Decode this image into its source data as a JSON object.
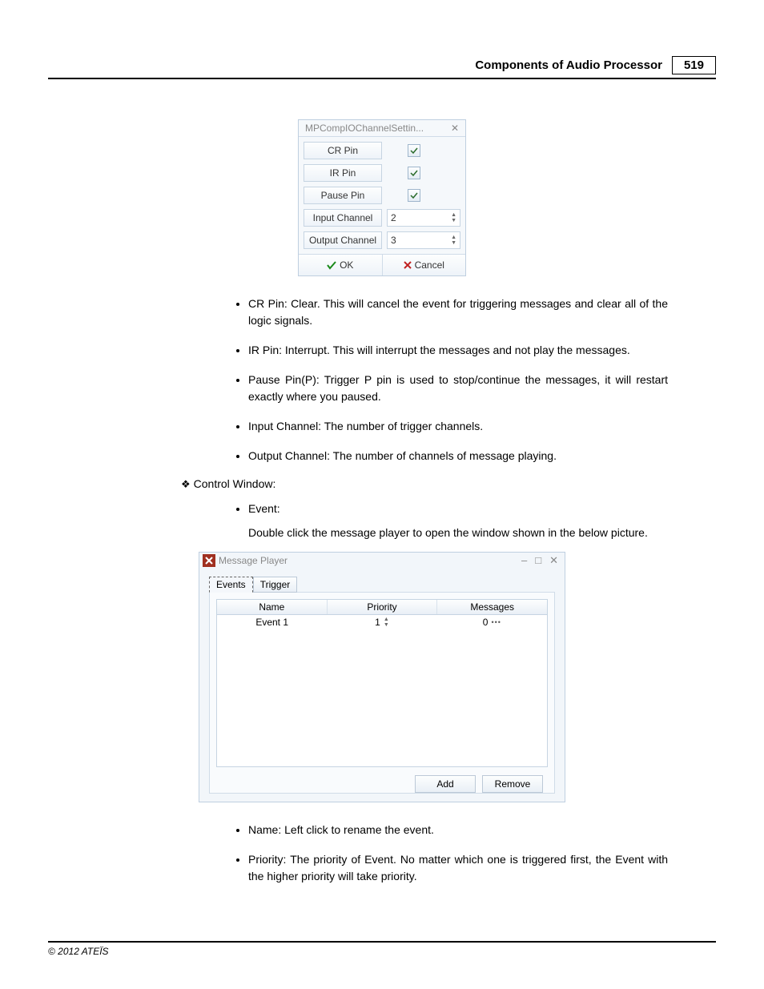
{
  "header": {
    "title": "Components of Audio Processor",
    "page": "519"
  },
  "dialog1": {
    "title": "MPCompIOChannelSettin...",
    "rows": {
      "cr": "CR Pin",
      "ir": "IR Pin",
      "pause": "Pause Pin",
      "input_ch_label": "Input Channel",
      "input_ch_value": "2",
      "output_ch_label": "Output Channel",
      "output_ch_value": "3"
    },
    "ok": "OK",
    "cancel": "Cancel"
  },
  "bullets1": [
    "CR Pin: Clear. This will cancel the event for triggering messages and clear all of the logic signals.",
    "IR Pin: Interrupt. This will interrupt the messages and not play the messages.",
    "Pause Pin(P): Trigger P pin is used to stop/continue the messages, it will restart exactly where you paused.",
    "Input Channel: The number of trigger channels.",
    "Output Channel: The number of channels of message playing."
  ],
  "section": {
    "heading": "Control Window:",
    "event_label": "Event:",
    "event_desc": "Double click the message player to open the window shown in the below picture."
  },
  "dialog2": {
    "title": "Message Player",
    "tabs": {
      "events": "Events",
      "trigger": "Trigger"
    },
    "columns": {
      "name": "Name",
      "priority": "Priority",
      "messages": "Messages"
    },
    "row1": {
      "name": "Event 1",
      "priority": "1",
      "messages": "0"
    },
    "buttons": {
      "add": "Add",
      "remove": "Remove"
    }
  },
  "bullets2": [
    "Name: Left click to rename the event.",
    "Priority: The priority of Event. No matter which one is triggered first, the Event with the higher priority will take priority."
  ],
  "footer": "© 2012 ATEÏS"
}
